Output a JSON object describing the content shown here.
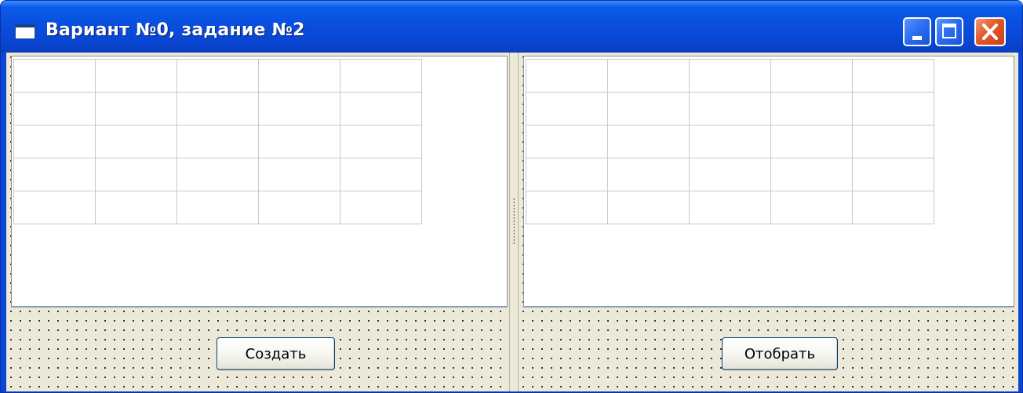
{
  "window": {
    "title": "Вариант №0, задание №2"
  },
  "left_panel": {
    "grid": {
      "rows": 5,
      "cols": 5
    },
    "button_label": "Создать"
  },
  "right_panel": {
    "grid": {
      "rows": 5,
      "cols": 5
    },
    "button_label": "Отобрать"
  },
  "icons": {
    "system": "window-icon",
    "minimize": "minimize-icon",
    "maximize": "maximize-icon",
    "close": "close-icon"
  },
  "colors": {
    "titlebar": "#0a4fde",
    "close_button": "#e2582a",
    "form_background": "#ece9d8"
  }
}
